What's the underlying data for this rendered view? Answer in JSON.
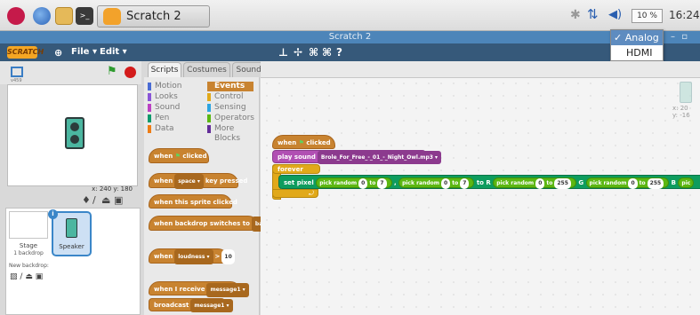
{
  "taskbar": {
    "app_button_label": "Scratch 2",
    "volume_level": "10 %",
    "clock": "16:24"
  },
  "window": {
    "title": "Scratch 2"
  },
  "menubar": {
    "logo_text": "SCRATCH",
    "file_menu": "File ▾",
    "edit_menu": "Edit ▾"
  },
  "audio_dropdown": {
    "options": [
      "Analog",
      "HDMI"
    ],
    "selected": "Analog",
    "selected_check": "✓"
  },
  "stage": {
    "version_label": "v459",
    "coords": "x: 240  y: 180",
    "stage_label": "Stage",
    "backdrop_count": "1 backdrop",
    "new_backdrop_label": "New backdrop:",
    "sprite_name": "Speaker",
    "sprite_info_badge": "i"
  },
  "tabs": [
    "Scripts",
    "Costumes",
    "Sounds"
  ],
  "categories": [
    {
      "name": "Motion",
      "color": "#4a6cd4"
    },
    {
      "name": "Looks",
      "color": "#8a55d7"
    },
    {
      "name": "Sound",
      "color": "#bb42c3"
    },
    {
      "name": "Pen",
      "color": "#0e9a6c"
    },
    {
      "name": "Data",
      "color": "#ee7d16"
    },
    {
      "name": "Events",
      "color": "#c88330"
    },
    {
      "name": "Control",
      "color": "#e1a91a"
    },
    {
      "name": "Sensing",
      "color": "#2ca5e2"
    },
    {
      "name": "Operators",
      "color": "#5cb712"
    },
    {
      "name": "More Blocks",
      "color": "#632d99"
    }
  ],
  "palette_blocks": {
    "when_flag_1": "when",
    "when_flag_2": "clicked",
    "key_1": "when",
    "key_dd": "space ▾",
    "key_2": "key pressed",
    "sprite_clicked": "when this sprite clicked",
    "backdrop_1": "when backdrop switches to",
    "backdrop_dd": "backd",
    "loudness_1": "when",
    "loudness_dd": "loudness ▾",
    "loudness_op": ">",
    "loudness_val": "10",
    "receive_1": "when I receive",
    "receive_dd": "message1 ▾",
    "broadcast_1": "broadcast",
    "broadcast_dd": "message1 ▾"
  },
  "script": {
    "hat_1": "when",
    "hat_2": "clicked",
    "play_label": "play sound",
    "play_sound_file": "Brole_For_Free_-_01_-_Night_Owl.mp3 ▾",
    "forever": "forever",
    "set_pixel": "set pixel",
    "pick_random_1": "pick random",
    "rand_a_from": "0",
    "to_1": "to",
    "rand_a_to": "7",
    "sep_1": ",",
    "pick_random_2": "pick random",
    "rand_b_from": "0",
    "to_2": "to",
    "rand_b_to": "7",
    "to_r": "to R",
    "pick_random_3": "pick random",
    "rand_c_from": "0",
    "to_3": "to",
    "rand_c_to": "255",
    "g_label": "G",
    "pick_random_4": "pick random",
    "rand_d_from": "0",
    "to_4": "to",
    "rand_d_to": "255",
    "b_label": "B",
    "pick_random_5": "pic"
  },
  "sprite_info": {
    "x": "x: 20",
    "y": "y: -16"
  }
}
